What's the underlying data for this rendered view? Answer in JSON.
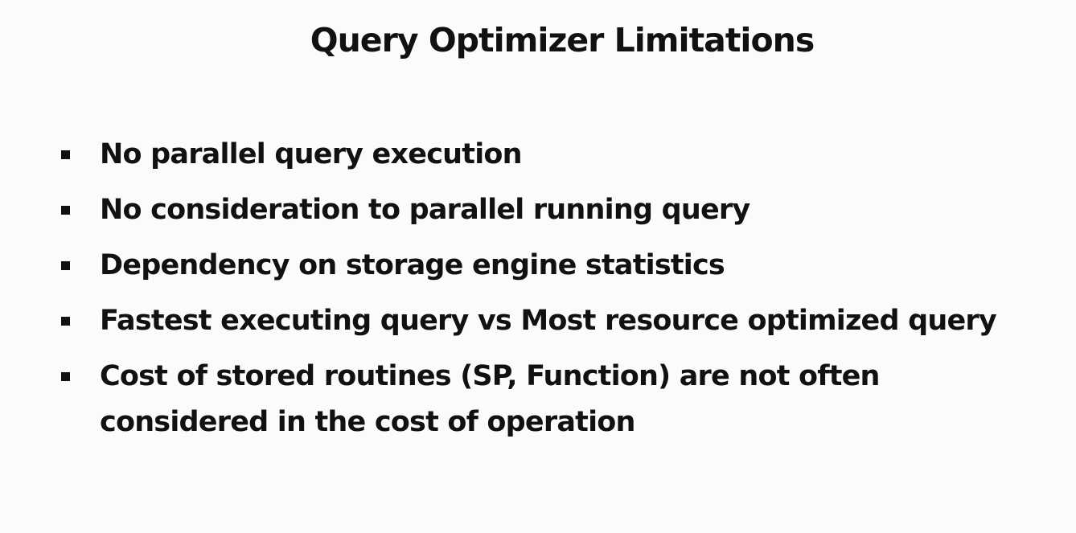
{
  "slide": {
    "title": "Query Optimizer Limitations",
    "bullets": [
      "No parallel query execution",
      "No consideration to parallel running query",
      "Dependency on storage engine statistics",
      "Fastest executing query vs Most resource optimized query",
      "Cost of stored routines (SP, Function) are not often considered in the cost of operation"
    ]
  }
}
